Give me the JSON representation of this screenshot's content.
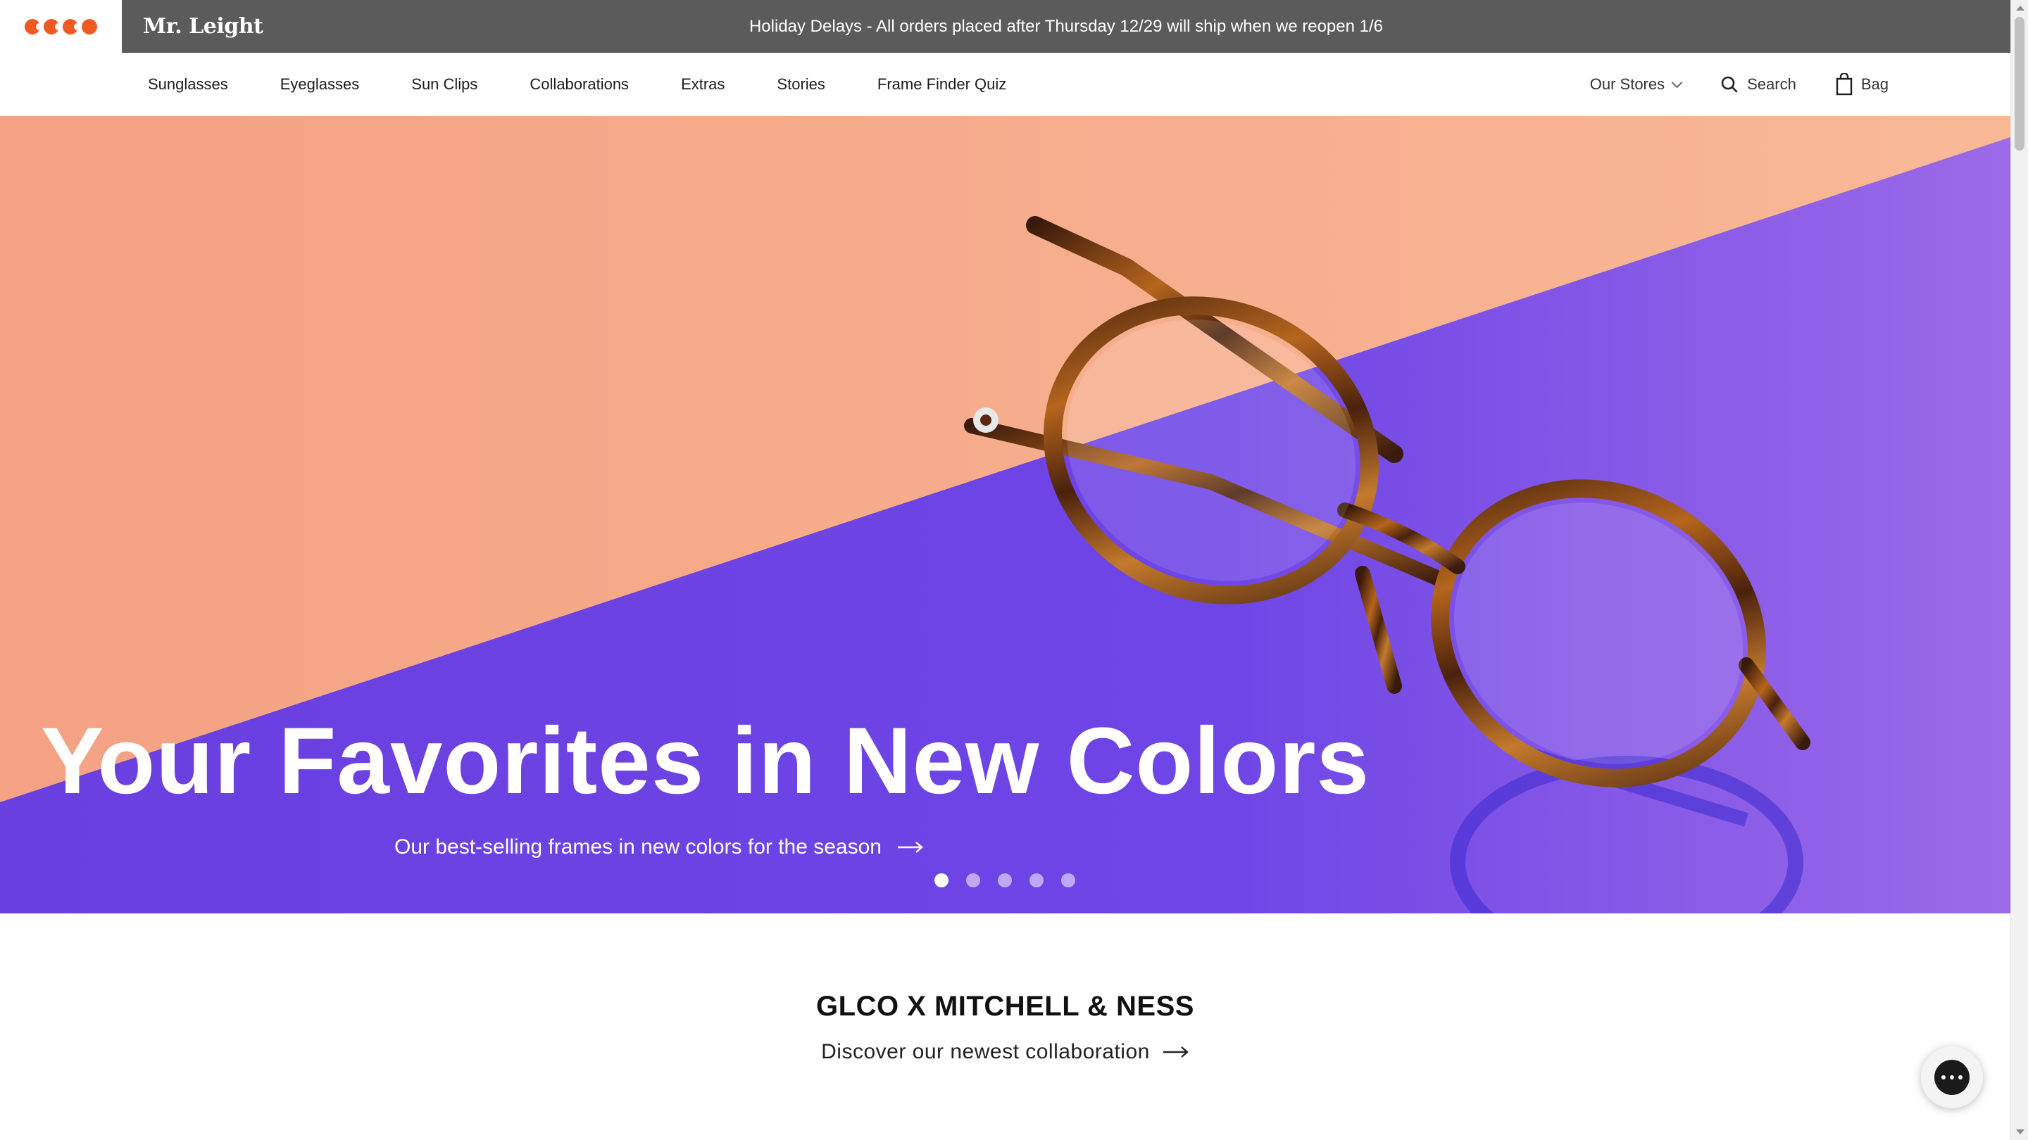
{
  "announcement": {
    "brand": "Mr. Leight",
    "text": "Holiday Delays - All orders placed after Thursday 12/29 will ship when we reopen 1/6"
  },
  "nav": {
    "links": [
      "Sunglasses",
      "Eyeglasses",
      "Sun Clips",
      "Collaborations",
      "Extras",
      "Stories",
      "Frame Finder Quiz"
    ],
    "stores_label": "Our Stores",
    "search_label": "Search",
    "bag_label": "Bag"
  },
  "hero": {
    "title": "Your Favorites in New Colors",
    "subtitle": "Our best-selling frames in new colors for the season",
    "slide_count": 5,
    "active_slide": 1
  },
  "collab": {
    "title": "GLCO X MITCHELL & NESS",
    "link": "Discover our newest collaboration"
  },
  "colors": {
    "accent": "#ee5a21",
    "announce_bg": "#5b5b5b",
    "hero_orange": "#f5a585",
    "hero_purple": "#6f3fe6"
  },
  "icons": [
    "glco-logo-icon",
    "chevron-down-icon",
    "search-icon",
    "bag-icon",
    "arrow-right-icon",
    "chat-icon"
  ]
}
